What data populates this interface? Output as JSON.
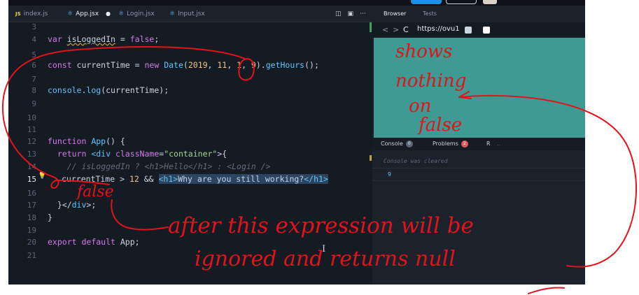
{
  "editor": {
    "tabs": [
      {
        "label": "index.js",
        "icon": "js-icon"
      },
      {
        "label": "App.jsx",
        "icon": "react-icon"
      },
      {
        "label": "Login.jsx",
        "icon": "react-icon"
      },
      {
        "label": "Input.jsx",
        "icon": "react-icon"
      }
    ],
    "tools": [
      "split-editor-icon",
      "preview-icon",
      "more-icon"
    ],
    "more_label": "···",
    "line_numbers": [
      "3",
      "4",
      "5",
      "6",
      "7",
      "8",
      "9",
      "10",
      "11",
      "12",
      "13",
      "14",
      "15",
      "16",
      "17",
      "18",
      "19",
      "20",
      "21"
    ],
    "lines": {
      "l4a": "var ",
      "l4b": "isLoggedIn",
      "l4c": " = ",
      "l4d": "false",
      "l4e": ";",
      "l6a": "const ",
      "l6b": "currentTime",
      "l6c": " = ",
      "l6d": "new ",
      "l6e": "Date",
      "l6f": "(",
      "l6g": "2019",
      "l6h": ", ",
      "l6i": "11",
      "l6j": ", ",
      "l6k": "1",
      "l6l": ", ",
      "l6m": "9",
      "l6n": ").",
      "l6o": "getHours",
      "l6p": "();",
      "l8a": "console",
      "l8b": ".",
      "l8c": "log",
      "l8d": "(currentTime);",
      "l12a": "function ",
      "l12b": "App",
      "l12c": "() {",
      "l13a": "  return ",
      "l13b": "<div ",
      "l13c": "className",
      "l13d": "=",
      "l13e": "\"container\"",
      "l13f": ">{",
      "l14": "    // isLoggedIn ? <h1>Hello</h1> : <Login />",
      "l15a": "currentTime > ",
      "l15b": "12",
      "l15c": " && ",
      "l15d": "<h1>",
      "l15e": "Why are you still working?",
      "l15f": "</h1>",
      "l17a": "  }</",
      "l17b": "div",
      "l17c": ">;",
      "l18": "}",
      "l20a": "export ",
      "l20b": "default ",
      "l20c": "App;"
    }
  },
  "browser": {
    "tabs": [
      "Browser",
      "Tests"
    ],
    "nav": {
      "back": "<",
      "forward": ">",
      "reload": "C"
    },
    "url": "https://ovu1",
    "viewport_color": "#3e9a93",
    "console_tabs": [
      {
        "label": "Console",
        "badge": "0"
      },
      {
        "label": "Problems",
        "badge": "2"
      },
      {
        "label": "R"
      }
    ],
    "console_more": "..",
    "console_lines": [
      "Console was cleared",
      "9"
    ]
  },
  "annotations": {
    "color": "#e3131b",
    "shows": "shows",
    "nothing": "nothing",
    "on": "on",
    "false_browser": "false",
    "false_code": "false",
    "after": "after this expression will be",
    "ignored": "ignored and returns null"
  },
  "colors": {
    "editor_bg": "#151b23",
    "keyword": "#d27ae8",
    "function": "#5cc7ff",
    "string": "#9fd98a",
    "number": "#f2c38a",
    "ink": "#e3131b"
  }
}
